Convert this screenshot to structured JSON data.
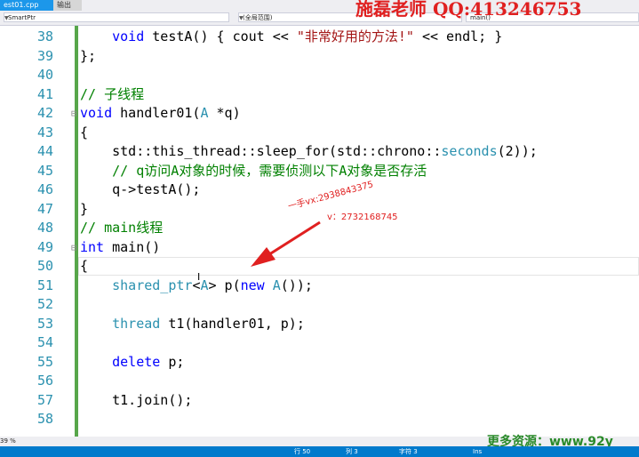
{
  "tabs": {
    "active": "est01.cpp",
    "other": "输出"
  },
  "nav": {
    "project": "SmartPtr",
    "scope": "(全局范围)",
    "member": "main()"
  },
  "watermark": {
    "top": "施磊老师 QQ:413246753",
    "middle1": "一手vx:",
    "middle2": "2938843375",
    "middle3": "v：2732168745",
    "bottom": "更多资源：www.92y"
  },
  "editor": {
    "lines": [
      {
        "n": "38",
        "fold": "",
        "tokens": [
          {
            "t": "    "
          },
          {
            "c": "kw",
            "t": "void"
          },
          {
            "t": " testA() { cout << "
          },
          {
            "c": "str",
            "t": "\"非常好用的方法!\""
          },
          {
            "t": " << endl; }"
          }
        ]
      },
      {
        "n": "39",
        "fold": "",
        "tokens": [
          {
            "t": "};"
          }
        ]
      },
      {
        "n": "40",
        "fold": "",
        "tokens": []
      },
      {
        "n": "41",
        "fold": "",
        "tokens": [
          {
            "c": "cm",
            "t": "// 子线程"
          }
        ]
      },
      {
        "n": "42",
        "fold": "⊟",
        "tokens": [
          {
            "c": "kw",
            "t": "void"
          },
          {
            "t": " handler01("
          },
          {
            "c": "ty",
            "t": "A"
          },
          {
            "t": " *q)"
          }
        ]
      },
      {
        "n": "43",
        "fold": "",
        "tokens": [
          {
            "t": "{"
          }
        ]
      },
      {
        "n": "44",
        "fold": "",
        "tokens": [
          {
            "t": "    std::this_thread::sleep_for(std::chrono::"
          },
          {
            "c": "ty",
            "t": "seconds"
          },
          {
            "t": "(2));"
          }
        ]
      },
      {
        "n": "45",
        "fold": "",
        "tokens": [
          {
            "c": "cm",
            "t": "    // q访问A对象的时候，需要侦测以下A对象是否存活"
          }
        ]
      },
      {
        "n": "46",
        "fold": "",
        "tokens": [
          {
            "t": "    q->testA();"
          }
        ]
      },
      {
        "n": "47",
        "fold": "",
        "tokens": [
          {
            "t": "}"
          }
        ]
      },
      {
        "n": "48",
        "fold": "",
        "tokens": [
          {
            "c": "cm",
            "t": "// main线程"
          }
        ]
      },
      {
        "n": "49",
        "fold": "⊟",
        "tokens": [
          {
            "c": "kw",
            "t": "int"
          },
          {
            "t": " main()"
          }
        ]
      },
      {
        "n": "50",
        "fold": "",
        "tokens": [
          {
            "t": "{"
          }
        ]
      },
      {
        "n": "51",
        "fold": "",
        "tokens": [
          {
            "t": "    "
          },
          {
            "c": "ty",
            "t": "shared_ptr"
          },
          {
            "t": "<"
          },
          {
            "c": "ty",
            "t": "A"
          },
          {
            "t": "> p("
          },
          {
            "c": "kw",
            "t": "new"
          },
          {
            "t": " "
          },
          {
            "c": "ty",
            "t": "A"
          },
          {
            "t": "());"
          }
        ]
      },
      {
        "n": "52",
        "fold": "",
        "tokens": []
      },
      {
        "n": "53",
        "fold": "",
        "tokens": [
          {
            "t": "    "
          },
          {
            "c": "ty",
            "t": "thread"
          },
          {
            "t": " t1(handler01, p);"
          }
        ]
      },
      {
        "n": "54",
        "fold": "",
        "tokens": []
      },
      {
        "n": "55",
        "fold": "",
        "tokens": [
          {
            "t": "    "
          },
          {
            "c": "kw",
            "t": "delete"
          },
          {
            "t": " p;"
          }
        ]
      },
      {
        "n": "56",
        "fold": "",
        "tokens": []
      },
      {
        "n": "57",
        "fold": "",
        "tokens": [
          {
            "t": "    t1.join();"
          }
        ]
      },
      {
        "n": "58",
        "fold": "",
        "tokens": []
      }
    ]
  },
  "zoom": "39 %",
  "status": {
    "row": "行 50",
    "col": "列 3",
    "char": "字符 3",
    "mode": "Ins"
  }
}
